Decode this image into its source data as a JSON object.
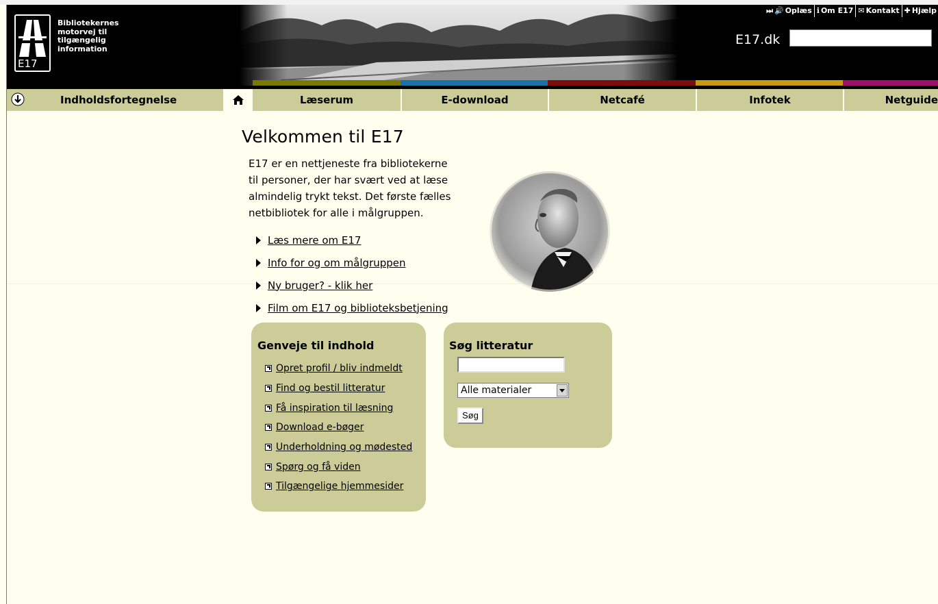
{
  "header": {
    "logo_text": "E17",
    "tagline": [
      "Bibliotekernes",
      "motorvej til",
      "tilgængelig",
      "information"
    ],
    "top_links": [
      {
        "label": "Oplæs",
        "icon": "speaker-icon"
      },
      {
        "label": "Om E17",
        "icon": "info-icon"
      },
      {
        "label": "Kontakt",
        "icon": "envelope-icon"
      },
      {
        "label": "Hjælp",
        "icon": "plus-icon"
      }
    ],
    "site_label": "E17.dk",
    "site_search_value": "",
    "color_strip": [
      "#7a7a00",
      "#1a73a8",
      "#7a0e0e",
      "#c89a10",
      "#a0106a"
    ]
  },
  "nav": {
    "toc_label": "Indholdsfortegnelse",
    "home_icon": "home-icon",
    "tabs": [
      {
        "label": "Læserum"
      },
      {
        "label": "E-download"
      },
      {
        "label": "Netcafé"
      },
      {
        "label": "Infotek"
      },
      {
        "label": "Netguide"
      }
    ]
  },
  "main": {
    "title": "Velkommen til E17",
    "intro": [
      "E17 er en nettjeneste fra bibliotekerne",
      "til personer, der har svært ved at læse",
      "almindelig trykt tekst. Det første fælles",
      "netbibliotek for alle i målgruppen."
    ],
    "links": [
      {
        "label": "Læs mere om E17"
      },
      {
        "label": "Info for og om målgruppen"
      },
      {
        "label": "Ny bruger? - klik her"
      },
      {
        "label": "Film om E17 og biblioteksbetjening"
      }
    ]
  },
  "shortcuts": {
    "title": "Genveje til indhold",
    "items": [
      {
        "label": "Opret profil / bliv indmeldt"
      },
      {
        "label": "Find og bestil litteratur"
      },
      {
        "label": "Få inspiration til læsning"
      },
      {
        "label": "Download e-bøger"
      },
      {
        "label": "Underholdning og mødested"
      },
      {
        "label": "Spørg og få viden"
      },
      {
        "label": "Tilgængelige hjemmesider"
      }
    ]
  },
  "search": {
    "title": "Søg litteratur",
    "input_value": "",
    "select_value": "Alle materialer",
    "button_label": "Søg"
  }
}
